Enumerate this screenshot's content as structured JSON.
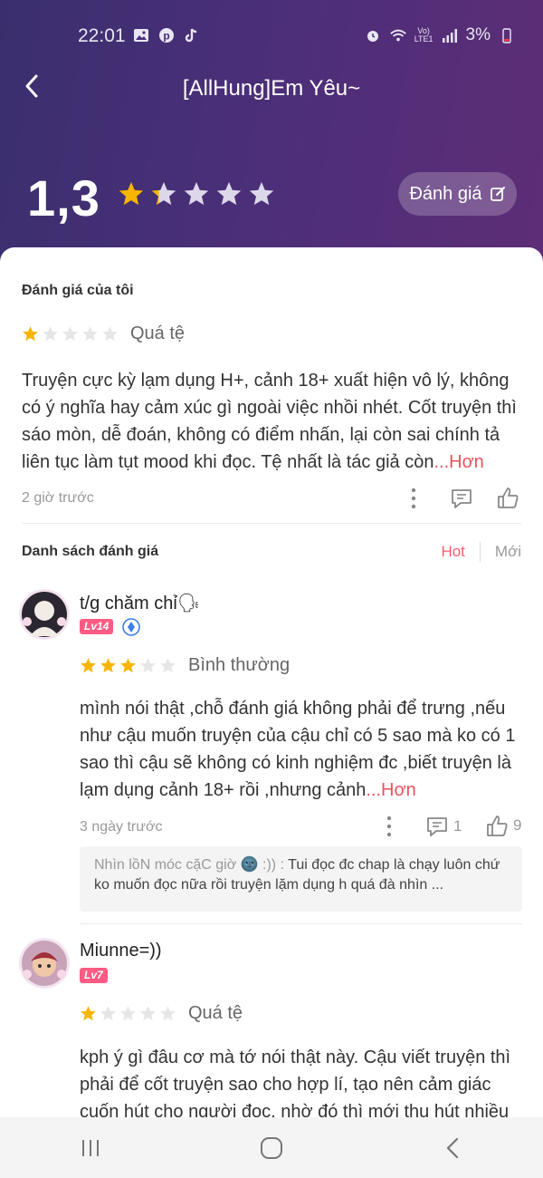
{
  "status_bar": {
    "time": "22:01",
    "battery": "3%",
    "volte_top": "Vo)",
    "volte_bottom": "LTE1",
    "left_icons": [
      "gallery-icon",
      "pinterest-icon",
      "tiktok-icon"
    ],
    "right_icons": [
      "alarm-icon",
      "wifi-icon",
      "signal-icon",
      "battery-low-icon"
    ]
  },
  "header": {
    "title": "[AllHung]Em Yêu~",
    "rating_value": "1,3",
    "rating_stars": 1.3,
    "rate_button_label": "Đánh giá"
  },
  "my_review": {
    "section_title": "Đánh giá của tôi",
    "stars": 1,
    "star_label": "Quá tệ",
    "text": "Truyện cực kỳ lạm dụng H+, cảnh 18+ xuất hiện vô lý, không có ý nghĩa hay cảm xúc gì ngoài việc nhồi nhét. Cốt truyện thì sáo mòn, dễ đoán, không có điểm nhấn, lại còn sai chính tả liên tục làm tụt mood khi đọc. Tệ nhất là tác giả còn",
    "more": "...Hơn",
    "time": "2 giờ trước"
  },
  "list": {
    "title": "Danh sách đánh giá",
    "tab_hot": "Hot",
    "tab_new": "Mới"
  },
  "reviews": [
    {
      "username": "t/g chăm chỉ🗣",
      "level": "Lv14",
      "stars": 3,
      "star_label": "Bình thường",
      "text": "mình nói thật ,chỗ đánh giá không phải để trưng ,nếu như cậu muốn truyện của cậu chỉ có 5 sao mà ko có 1 sao thì cậu sẽ không có kinh nghiệm đc ,biết truyện là lạm dụng cảnh 18+ rồi ,nhưng cảnh",
      "more": "...Hơn",
      "time": "3 ngày trước",
      "comments": "1",
      "likes": "9",
      "reply_name": "Nhìn lồN móc cặC giờ 🌚 :)) :",
      "reply_text": "Tui đọc đc chap là chạy luôn chứ ko muốn đọc nữa rồi truyện lặm dụng h quá đà nhìn ..."
    },
    {
      "username": "Miunne=))",
      "level": "Lv7",
      "stars": 1,
      "star_label": "Quá tệ",
      "text": "kph ý gì đâu cơ mà tớ nói thật này. Cậu viết truyện thì phải để cốt truyện sao cho hợp lí, tạo nên cảm giác cuốn hút cho người đọc, nhờ đó thì mới thu hút nhiều"
    }
  ],
  "colors": {
    "header_gradient_start": "#3a2f6e",
    "header_gradient_end": "#5e2d77",
    "star_filled": "#f7b500",
    "star_empty": "#e6e6e6",
    "accent": "#e8535f",
    "level_badge": "#ff5b84"
  }
}
